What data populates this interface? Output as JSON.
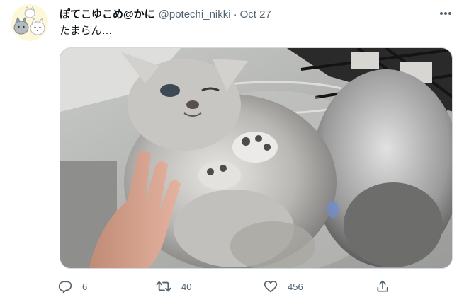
{
  "tweet": {
    "display_name": "ぽてこゆこめ@かに",
    "handle": "@potechi_nikki",
    "separator": "·",
    "timestamp": "Oct 27",
    "text": "たまらん…",
    "avatar": {
      "icon": "cats-avatar-icon",
      "background": "#fdf8da"
    },
    "more_icon": "more-horizontal-icon"
  },
  "actions": {
    "reply": {
      "icon": "reply-icon",
      "count": "6"
    },
    "retweet": {
      "icon": "retweet-icon",
      "count": "40"
    },
    "like": {
      "icon": "heart-icon",
      "count": "456"
    },
    "share": {
      "icon": "share-icon"
    }
  },
  "colors": {
    "text_primary": "#0f1419",
    "text_secondary": "#536471",
    "border": "#cfd9de"
  }
}
